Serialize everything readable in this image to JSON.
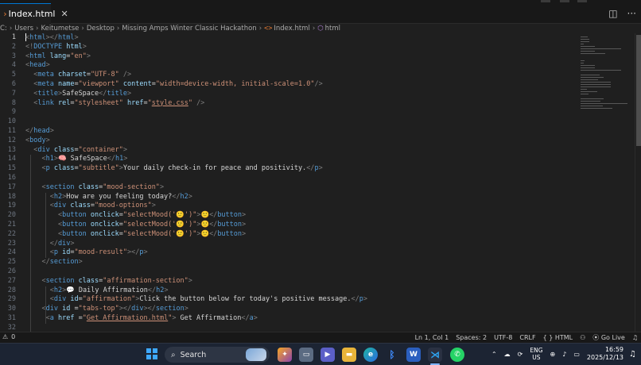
{
  "tabs": [
    {
      "label": "Index.html",
      "icon": "html-file-icon",
      "close": "✕"
    }
  ],
  "breadcrumb": {
    "items": [
      "C:",
      "Users",
      "Keitumetse",
      "Desktop",
      "Missing Amps Winter Classic Hackathon",
      "Index.html",
      "html"
    ]
  },
  "editor": {
    "line_numbers": [
      "1",
      "2",
      "3",
      "4",
      "5",
      "6",
      "7",
      "8",
      "9",
      "10",
      "11",
      "12",
      "13",
      "14",
      "15",
      "16",
      "17",
      "18",
      "19",
      "20",
      "21",
      "22",
      "23",
      "24",
      "25",
      "26",
      "27",
      "28",
      "29",
      "30",
      "31",
      "32"
    ],
    "active_line": 1,
    "lines": [
      [
        [
          "brk",
          "<"
        ],
        [
          "tag",
          "html"
        ],
        [
          "brk",
          ">"
        ],
        [
          "brk",
          "</"
        ],
        [
          "tag",
          "html"
        ],
        [
          "brk",
          ">"
        ]
      ],
      [
        [
          "brk",
          "<!"
        ],
        [
          "tag",
          "DOCTYPE"
        ],
        [
          "txt",
          " "
        ],
        [
          "attr",
          "html"
        ],
        [
          "brk",
          ">"
        ]
      ],
      [
        [
          "brk",
          "<"
        ],
        [
          "tag",
          "html"
        ],
        [
          "txt",
          " "
        ],
        [
          "attr",
          "lang"
        ],
        [
          "txt",
          "="
        ],
        [
          "str",
          "\"en\""
        ],
        [
          "brk",
          ">"
        ]
      ],
      [
        [
          "brk",
          "<"
        ],
        [
          "tag",
          "head"
        ],
        [
          "brk",
          ">"
        ]
      ],
      [
        [
          "txt",
          "  "
        ],
        [
          "brk",
          "<"
        ],
        [
          "tag",
          "meta"
        ],
        [
          "txt",
          " "
        ],
        [
          "attr",
          "charset"
        ],
        [
          "txt",
          "="
        ],
        [
          "str",
          "\"UTF-8\""
        ],
        [
          "txt",
          " "
        ],
        [
          "brk",
          "/>"
        ]
      ],
      [
        [
          "txt",
          "  "
        ],
        [
          "brk",
          "<"
        ],
        [
          "tag",
          "meta"
        ],
        [
          "txt",
          " "
        ],
        [
          "attr",
          "name"
        ],
        [
          "txt",
          "="
        ],
        [
          "str",
          "\"viewport\""
        ],
        [
          "txt",
          " "
        ],
        [
          "attr",
          "content"
        ],
        [
          "txt",
          "="
        ],
        [
          "str",
          "\"width=device-width, initial-scale=1.0\""
        ],
        [
          "brk",
          "/>"
        ]
      ],
      [
        [
          "txt",
          "  "
        ],
        [
          "brk",
          "<"
        ],
        [
          "tag",
          "title"
        ],
        [
          "brk",
          ">"
        ],
        [
          "txt",
          "SafeSpace"
        ],
        [
          "brk",
          "</"
        ],
        [
          "tag",
          "title"
        ],
        [
          "brk",
          ">"
        ]
      ],
      [
        [
          "txt",
          "  "
        ],
        [
          "brk",
          "<"
        ],
        [
          "tag",
          "link"
        ],
        [
          "txt",
          " "
        ],
        [
          "attr",
          "rel"
        ],
        [
          "txt",
          "="
        ],
        [
          "str",
          "\"stylesheet\""
        ],
        [
          "txt",
          " "
        ],
        [
          "attr",
          "href"
        ],
        [
          "txt",
          "="
        ],
        [
          "str",
          "\""
        ],
        [
          "link",
          "style.css"
        ],
        [
          "str",
          "\""
        ],
        [
          "txt",
          " "
        ],
        [
          "brk",
          "/>"
        ]
      ],
      [],
      [],
      [
        [
          "brk",
          "</"
        ],
        [
          "tag",
          "head"
        ],
        [
          "brk",
          ">"
        ]
      ],
      [
        [
          "brk",
          "<"
        ],
        [
          "tag",
          "body"
        ],
        [
          "brk",
          ">"
        ]
      ],
      [
        [
          "txt",
          "  "
        ],
        [
          "brk",
          "<"
        ],
        [
          "tag",
          "div"
        ],
        [
          "txt",
          " "
        ],
        [
          "attr",
          "class"
        ],
        [
          "txt",
          "="
        ],
        [
          "str",
          "\"container\""
        ],
        [
          "brk",
          ">"
        ]
      ],
      [
        [
          "txt",
          "    "
        ],
        [
          "brk",
          "<"
        ],
        [
          "tag",
          "h1"
        ],
        [
          "brk",
          ">"
        ],
        [
          "txt",
          "🧠 SafeSpace"
        ],
        [
          "brk",
          "</"
        ],
        [
          "tag",
          "h1"
        ],
        [
          "brk",
          ">"
        ]
      ],
      [
        [
          "txt",
          "    "
        ],
        [
          "brk",
          "<"
        ],
        [
          "tag",
          "p"
        ],
        [
          "txt",
          " "
        ],
        [
          "attr",
          "class"
        ],
        [
          "txt",
          "="
        ],
        [
          "str",
          "\"subtitle\""
        ],
        [
          "brk",
          ">"
        ],
        [
          "txt",
          "Your daily check-in for peace and positivity."
        ],
        [
          "brk",
          "</"
        ],
        [
          "tag",
          "p"
        ],
        [
          "brk",
          ">"
        ]
      ],
      [],
      [
        [
          "txt",
          "    "
        ],
        [
          "brk",
          "<"
        ],
        [
          "tag",
          "section"
        ],
        [
          "txt",
          " "
        ],
        [
          "attr",
          "class"
        ],
        [
          "txt",
          "="
        ],
        [
          "str",
          "\"mood-section\""
        ],
        [
          "brk",
          ">"
        ]
      ],
      [
        [
          "txt",
          "      "
        ],
        [
          "brk",
          "<"
        ],
        [
          "tag",
          "h2"
        ],
        [
          "brk",
          ">"
        ],
        [
          "txt",
          "How are you feeling today?"
        ],
        [
          "brk",
          "</"
        ],
        [
          "tag",
          "h2"
        ],
        [
          "brk",
          ">"
        ]
      ],
      [
        [
          "txt",
          "      "
        ],
        [
          "brk",
          "<"
        ],
        [
          "tag",
          "div"
        ],
        [
          "txt",
          " "
        ],
        [
          "attr",
          "class"
        ],
        [
          "txt",
          "="
        ],
        [
          "str",
          "\"mood-options\""
        ],
        [
          "brk",
          ">"
        ]
      ],
      [
        [
          "txt",
          "        "
        ],
        [
          "brk",
          "<"
        ],
        [
          "tag",
          "button"
        ],
        [
          "txt",
          " "
        ],
        [
          "attr",
          "onclick"
        ],
        [
          "txt",
          "="
        ],
        [
          "str",
          "\"selectMood('🙂')\""
        ],
        [
          "brk",
          ">"
        ],
        [
          "txt",
          "🙂"
        ],
        [
          "brk",
          "</"
        ],
        [
          "tag",
          "button"
        ],
        [
          "brk",
          ">"
        ]
      ],
      [
        [
          "txt",
          "        "
        ],
        [
          "brk",
          "<"
        ],
        [
          "tag",
          "button"
        ],
        [
          "txt",
          " "
        ],
        [
          "attr",
          "onclick"
        ],
        [
          "txt",
          "="
        ],
        [
          "str",
          "\"selectMood('🙂')\""
        ],
        [
          "brk",
          ">"
        ],
        [
          "txt",
          "🙂"
        ],
        [
          "brk",
          "</"
        ],
        [
          "tag",
          "button"
        ],
        [
          "brk",
          ">"
        ]
      ],
      [
        [
          "txt",
          "        "
        ],
        [
          "brk",
          "<"
        ],
        [
          "tag",
          "button"
        ],
        [
          "txt",
          " "
        ],
        [
          "attr",
          "onclick"
        ],
        [
          "txt",
          "="
        ],
        [
          "str",
          "\"selectMood('🙂')\""
        ],
        [
          "brk",
          ">"
        ],
        [
          "txt",
          "🙂"
        ],
        [
          "brk",
          "</"
        ],
        [
          "tag",
          "button"
        ],
        [
          "brk",
          ">"
        ]
      ],
      [
        [
          "txt",
          "      "
        ],
        [
          "brk",
          "</"
        ],
        [
          "tag",
          "div"
        ],
        [
          "brk",
          ">"
        ]
      ],
      [
        [
          "txt",
          "      "
        ],
        [
          "brk",
          "<"
        ],
        [
          "tag",
          "p"
        ],
        [
          "txt",
          " "
        ],
        [
          "attr",
          "id"
        ],
        [
          "txt",
          "="
        ],
        [
          "str",
          "\"mood-result\""
        ],
        [
          "brk",
          "></"
        ],
        [
          "tag",
          "p"
        ],
        [
          "brk",
          ">"
        ]
      ],
      [
        [
          "txt",
          "    "
        ],
        [
          "brk",
          "</"
        ],
        [
          "tag",
          "section"
        ],
        [
          "brk",
          ">"
        ]
      ],
      [],
      [
        [
          "txt",
          "    "
        ],
        [
          "brk",
          "<"
        ],
        [
          "tag",
          "section"
        ],
        [
          "txt",
          " "
        ],
        [
          "attr",
          "class"
        ],
        [
          "txt",
          "="
        ],
        [
          "str",
          "\"affirmation-section\""
        ],
        [
          "brk",
          ">"
        ]
      ],
      [
        [
          "txt",
          "      "
        ],
        [
          "brk",
          "<"
        ],
        [
          "tag",
          "h2"
        ],
        [
          "brk",
          ">"
        ],
        [
          "txt",
          "💬 Daily Affirmation"
        ],
        [
          "brk",
          "</"
        ],
        [
          "tag",
          "h2"
        ],
        [
          "brk",
          ">"
        ]
      ],
      [
        [
          "txt",
          "      "
        ],
        [
          "brk",
          "<"
        ],
        [
          "tag",
          "div"
        ],
        [
          "txt",
          " "
        ],
        [
          "attr",
          "id"
        ],
        [
          "txt",
          "="
        ],
        [
          "str",
          "\"affirmation\""
        ],
        [
          "brk",
          ">"
        ],
        [
          "txt",
          "Click the button below for today's positive message."
        ],
        [
          "brk",
          "</"
        ],
        [
          "tag",
          "p"
        ],
        [
          "brk",
          ">"
        ]
      ],
      [
        [
          "txt",
          "    "
        ],
        [
          "brk",
          "<"
        ],
        [
          "tag",
          "div"
        ],
        [
          "txt",
          " "
        ],
        [
          "attr",
          "id"
        ],
        [
          "txt",
          " ="
        ],
        [
          "str",
          "\"tabs-top\""
        ],
        [
          "brk",
          "></"
        ],
        [
          "tag",
          "div"
        ],
        [
          "brk",
          "></"
        ],
        [
          "tag",
          "section"
        ],
        [
          "brk",
          ">"
        ]
      ],
      [
        [
          "txt",
          "     "
        ],
        [
          "brk",
          "<"
        ],
        [
          "tag",
          "a"
        ],
        [
          "txt",
          " "
        ],
        [
          "attr",
          "href"
        ],
        [
          "txt",
          " ="
        ],
        [
          "str",
          "\""
        ],
        [
          "link",
          "Get Affirmation.html"
        ],
        [
          "str",
          "\""
        ],
        [
          "brk",
          ">"
        ],
        [
          "txt",
          " Get Affirmation"
        ],
        [
          "brk",
          "</"
        ],
        [
          "tag",
          "a"
        ],
        [
          "brk",
          ">"
        ]
      ],
      []
    ]
  },
  "statusbar": {
    "problems_icon": "⚠",
    "problems_count": "0",
    "position": "Ln 1, Col 1",
    "spaces": "Spaces: 2",
    "encoding": "UTF-8",
    "eol": "CRLF",
    "language": "{ } HTML",
    "copilot_icon": "copilot-icon",
    "go_live": "Go Live",
    "bell_icon": "bell-icon"
  },
  "taskbar": {
    "search_label": "Search",
    "lang_top": "ENG",
    "lang_bottom": "US",
    "time": "16:59",
    "date": "2025/12/13"
  }
}
